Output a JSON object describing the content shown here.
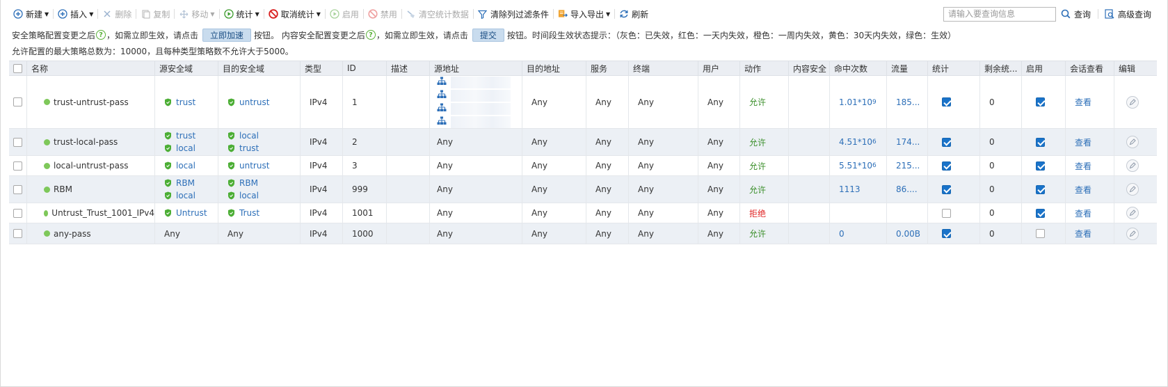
{
  "toolbar": {
    "new": "新建",
    "insert": "插入",
    "delete": "删除",
    "copy": "复制",
    "move": "移动",
    "stats": "统计",
    "cancel_stats": "取消统计",
    "enable": "启用",
    "disable": "禁用",
    "clear_stats": "清空统计数据",
    "clear_filter": "清除列过滤条件",
    "import_export": "导入导出",
    "refresh": "刷新",
    "search_placeholder": "请输入要查询信息",
    "search": "查询",
    "advanced_search": "高级查询"
  },
  "notice": {
    "part1": "安全策略配置变更之后",
    "part2": "，如需立即生效，请点击",
    "btn_accelerate": "立即加速",
    "part3": "按钮。 内容安全配置变更之后",
    "part4": "，如需立即生效，请点击",
    "btn_submit": "提交",
    "part5": "按钮。时间段生效状态提示：（灰色：已失效，红色：一天内失效，橙色：一周内失效，黄色：30天内失效，绿色：生效）"
  },
  "limit_text": "允许配置的最大策略总数为：10000，且每种类型策略数不允许大于5000。",
  "columns": {
    "name": "名称",
    "src_zone": "源安全域",
    "dst_zone": "目的安全域",
    "type": "类型",
    "id": "ID",
    "desc": "描述",
    "src_addr": "源地址",
    "dst_addr": "目的地址",
    "service": "服务",
    "terminal": "终端",
    "user": "用户",
    "action": "动作",
    "content_sec": "内容安全",
    "hits": "命中次数",
    "traffic": "流量",
    "stats": "统计",
    "remaining": "剩余统...",
    "enabled": "启用",
    "session": "会话查看",
    "edit": "编辑"
  },
  "rows": [
    {
      "name": "trust-untrust-pass",
      "src_zone": [
        "trust"
      ],
      "dst_zone": [
        "untrust"
      ],
      "type": "IPv4",
      "id": "1",
      "desc": "",
      "src_addr": "",
      "dst_addr": "Any",
      "service": "Any",
      "terminal": "Any",
      "user": "Any",
      "action": "允许",
      "action_kind": "allow",
      "content_sec": "",
      "hits_base": "1.01*10",
      "hits_exp": "9",
      "traffic": "185...",
      "stats": true,
      "remaining": "0",
      "enabled": true,
      "session": "查看"
    },
    {
      "name": "trust-local-pass",
      "src_zone": [
        "trust",
        "local"
      ],
      "dst_zone": [
        "local",
        "trust"
      ],
      "type": "IPv4",
      "id": "2",
      "desc": "",
      "src_addr": "Any",
      "dst_addr": "Any",
      "service": "Any",
      "terminal": "Any",
      "user": "Any",
      "action": "允许",
      "action_kind": "allow",
      "content_sec": "",
      "hits_base": "4.51*10",
      "hits_exp": "6",
      "traffic": "174...",
      "stats": true,
      "remaining": "0",
      "enabled": true,
      "session": "查看"
    },
    {
      "name": "local-untrust-pass",
      "src_zone": [
        "local"
      ],
      "dst_zone": [
        "untrust"
      ],
      "type": "IPv4",
      "id": "3",
      "desc": "",
      "src_addr": "Any",
      "dst_addr": "Any",
      "service": "Any",
      "terminal": "Any",
      "user": "Any",
      "action": "允许",
      "action_kind": "allow",
      "content_sec": "",
      "hits_base": "5.51*10",
      "hits_exp": "6",
      "traffic": "215...",
      "stats": true,
      "remaining": "0",
      "enabled": true,
      "session": "查看"
    },
    {
      "name": "RBM",
      "src_zone": [
        "RBM",
        "local"
      ],
      "dst_zone": [
        "RBM",
        "local"
      ],
      "type": "IPv4",
      "id": "999",
      "desc": "",
      "src_addr": "Any",
      "dst_addr": "Any",
      "service": "Any",
      "terminal": "Any",
      "user": "Any",
      "action": "允许",
      "action_kind": "allow",
      "content_sec": "",
      "hits_base": "1113",
      "hits_exp": "",
      "traffic": "86....",
      "stats": true,
      "remaining": "0",
      "enabled": true,
      "session": "查看"
    },
    {
      "name": "Untrust_Trust_1001_IPv4",
      "src_zone": [
        "Untrust"
      ],
      "dst_zone": [
        "Trust"
      ],
      "type": "IPv4",
      "id": "1001",
      "desc": "",
      "src_addr": "Any",
      "dst_addr": "Any",
      "service": "Any",
      "terminal": "Any",
      "user": "Any",
      "action": "拒绝",
      "action_kind": "deny",
      "content_sec": "",
      "hits_base": "",
      "hits_exp": "",
      "traffic": "",
      "stats": false,
      "remaining": "0",
      "enabled": true,
      "session": "查看"
    },
    {
      "name": "any-pass",
      "src_zone_plain": "Any",
      "dst_zone_plain": "Any",
      "src_zone": [],
      "dst_zone": [],
      "type": "IPv4",
      "id": "1000",
      "desc": "",
      "src_addr": "Any",
      "dst_addr": "Any",
      "service": "Any",
      "terminal": "Any",
      "user": "Any",
      "action": "允许",
      "action_kind": "allow",
      "content_sec": "",
      "hits_base": "0",
      "hits_exp": "",
      "traffic": "0.00B",
      "stats": true,
      "remaining": "0",
      "enabled": false,
      "session": "查看"
    }
  ],
  "colors": {
    "accent": "#2d6fb8",
    "allow": "#3b8f2b",
    "deny": "#e02424",
    "status_dot": "#7ec85a",
    "header_bg": "#ebeef3"
  },
  "icons": {
    "zone": "shield-icon",
    "address": "network-tree-icon",
    "edit": "pencil-icon",
    "status": "status-dot-icon"
  }
}
